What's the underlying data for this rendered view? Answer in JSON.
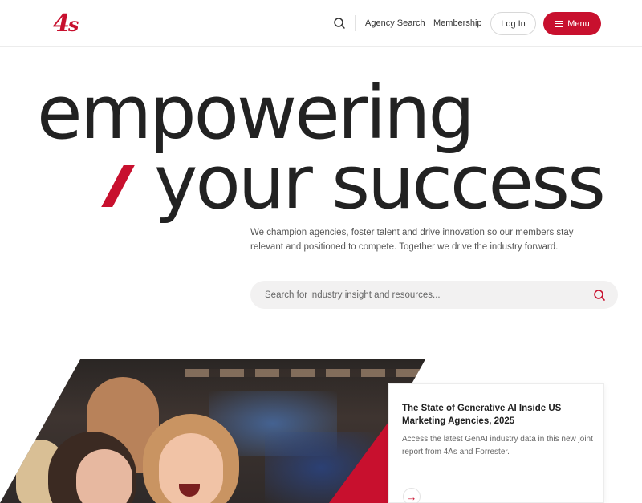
{
  "header": {
    "logo_text": "4",
    "logo_s": "s",
    "nav": {
      "agency_search": "Agency Search",
      "membership": "Membership"
    },
    "login_label": "Log In",
    "menu_label": "Menu",
    "search_icon": "search-icon",
    "menu_icon": "hamburger-icon"
  },
  "hero": {
    "line1": "empowering",
    "line2": "your success",
    "intro": "We champion agencies, foster talent and drive innovation so our members stay relevant and positioned to compete. Together we drive the industry forward."
  },
  "site_search": {
    "placeholder": "Search for industry insight and resources...",
    "icon": "search-icon"
  },
  "feature": {
    "title": "The State of Generative AI Inside US Marketing Agencies, 2025",
    "description": "Access the latest GenAI industry data in this new joint report from 4As and Forrester.",
    "arrow_icon": "arrow-right-icon",
    "arrow_glyph": "→"
  },
  "colors": {
    "brand_red": "#c8102e",
    "text_dark": "#222222",
    "search_bg": "#f2f1f1"
  }
}
